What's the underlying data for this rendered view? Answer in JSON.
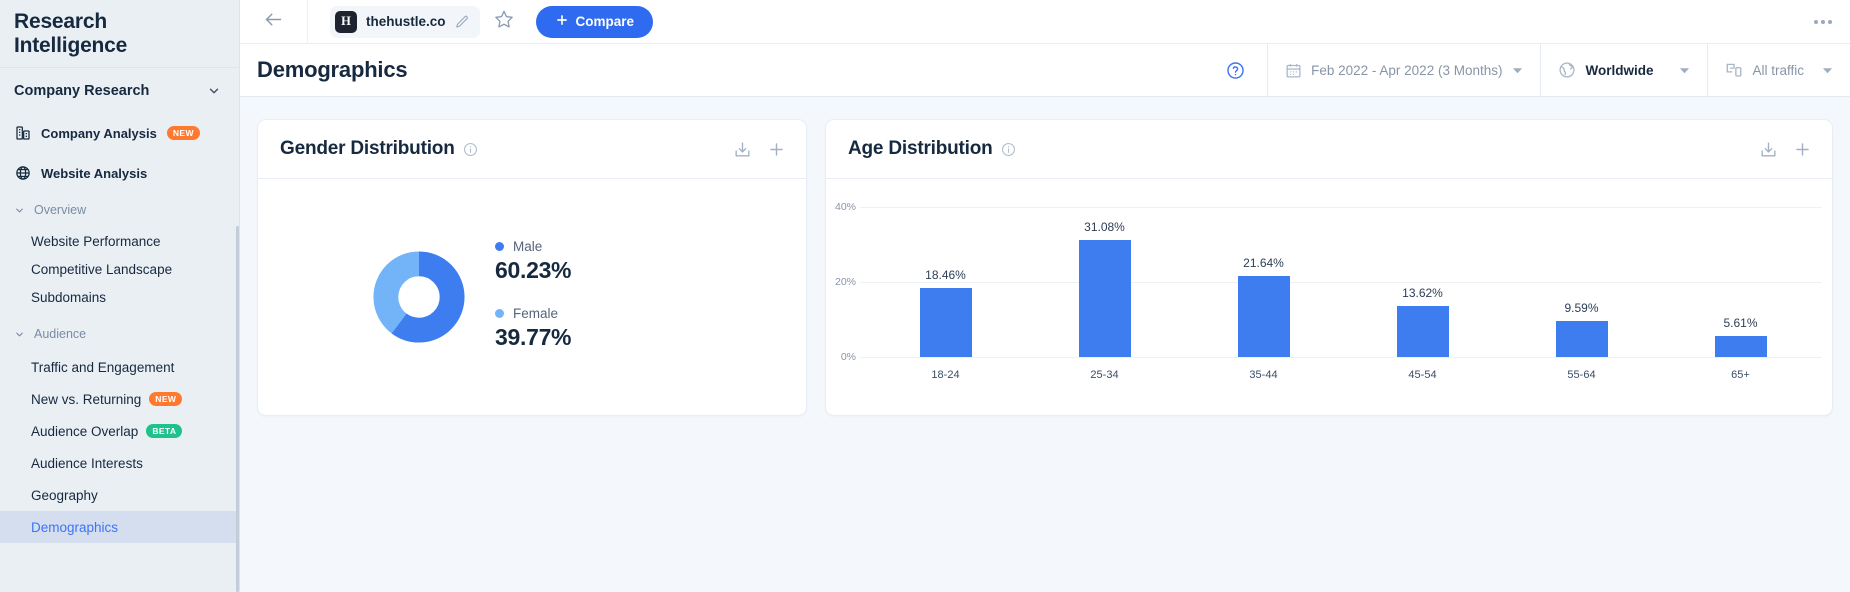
{
  "sidebar": {
    "brand": "Research Intelligence",
    "section": {
      "label": "Company Research",
      "icon": "chevron-down-icon"
    },
    "nav": [
      {
        "label": "Company Analysis",
        "icon": "building-icon",
        "badge": "NEW",
        "badge_type": "new"
      },
      {
        "label": "Website Analysis",
        "icon": "globe-icon",
        "badge": "",
        "badge_type": ""
      }
    ],
    "groups": [
      {
        "label": "Overview",
        "items": [
          {
            "label": "Website Performance",
            "active": false
          },
          {
            "label": "Competitive Landscape",
            "active": false
          },
          {
            "label": "Subdomains",
            "active": false
          }
        ]
      },
      {
        "label": "Audience",
        "items": [
          {
            "label": "Traffic and Engagement",
            "active": false,
            "badge": "",
            "badge_type": ""
          },
          {
            "label": "New vs. Returning",
            "active": false,
            "badge": "NEW",
            "badge_type": "new"
          },
          {
            "label": "Audience Overlap",
            "active": false,
            "badge": "BETA",
            "badge_type": "beta"
          },
          {
            "label": "Audience Interests",
            "active": false,
            "badge": "",
            "badge_type": ""
          },
          {
            "label": "Geography",
            "active": false,
            "badge": "",
            "badge_type": ""
          },
          {
            "label": "Demographics",
            "active": true,
            "badge": "",
            "badge_type": ""
          }
        ]
      }
    ]
  },
  "topbar": {
    "back_icon": "arrow-left-icon",
    "site": {
      "favicon_letter": "H",
      "name": "thehustle.co",
      "edit_icon": "pencil-icon"
    },
    "star_icon": "star-icon",
    "compare_label": "Compare",
    "overflow_icon": "more-horizontal-icon"
  },
  "filterbar": {
    "title": "Demographics",
    "help_icon": "question-circle-icon",
    "date_range": {
      "label": "Feb 2022 - Apr 2022 (3 Months)",
      "icon": "calendar-icon"
    },
    "geography": {
      "label": "Worldwide",
      "icon": "globe-icon"
    },
    "traffic": {
      "label": "All traffic",
      "icon": "devices-icon"
    }
  },
  "cards": {
    "gender": {
      "title": "Gender Distribution",
      "info_icon": "info-icon",
      "export_icon": "download-icon",
      "add_icon": "plus-icon"
    },
    "age": {
      "title": "Age Distribution",
      "info_icon": "info-icon",
      "export_icon": "download-icon",
      "add_icon": "plus-icon"
    }
  },
  "colors": {
    "accent": "#2f6bf0",
    "bar": "#3d7df0",
    "male": "#3d7df0",
    "female": "#72b4f7",
    "badge_new": "#ff7a2f",
    "badge_beta": "#1fc28a"
  },
  "chart_data": [
    {
      "type": "pie",
      "title": "Gender Distribution",
      "labels": [
        "Male",
        "Female"
      ],
      "values": [
        60.23,
        39.77
      ],
      "value_labels": [
        "60.23%",
        "39.77%"
      ],
      "colors": [
        "#3d7df0",
        "#72b4f7"
      ],
      "donut": true,
      "legend_position": "right"
    },
    {
      "type": "bar",
      "title": "Age Distribution",
      "categories": [
        "18-24",
        "25-34",
        "35-44",
        "45-54",
        "55-64",
        "65+"
      ],
      "values": [
        18.46,
        31.08,
        21.64,
        13.62,
        9.59,
        5.61
      ],
      "value_labels": [
        "18.46%",
        "31.08%",
        "21.64%",
        "13.62%",
        "9.59%",
        "5.61%"
      ],
      "yticks": [
        0,
        20,
        40
      ],
      "ytick_labels": [
        "0%",
        "20%",
        "40%"
      ],
      "ylim": [
        0,
        40
      ],
      "xlabel": "",
      "ylabel": "",
      "grid": true,
      "color": "#3d7df0"
    }
  ]
}
